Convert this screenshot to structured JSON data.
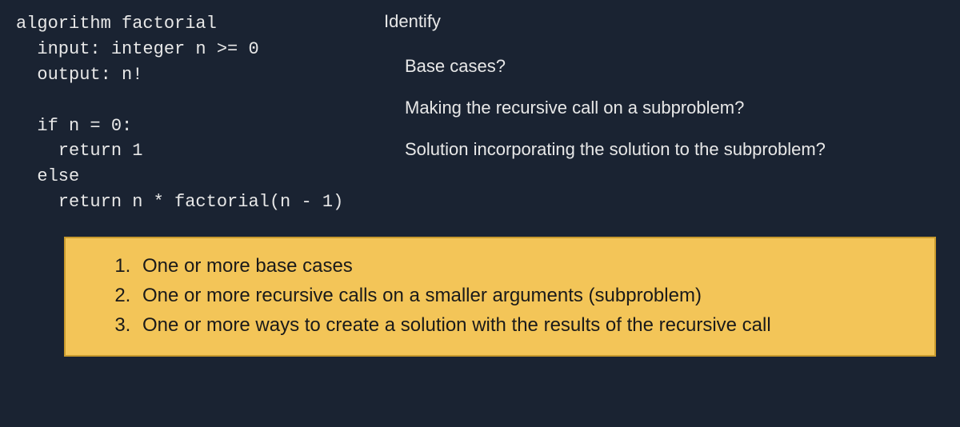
{
  "code": {
    "line1": "algorithm factorial",
    "line2": "  input: integer n >= 0",
    "line3": "  output: n!",
    "line4": "",
    "line5": "  if n = 0:",
    "line6": "    return 1",
    "line7": "  else",
    "line8": "    return n * factorial(n - 1)"
  },
  "right": {
    "title": "Identify",
    "q1": "Base cases?",
    "q2": "Making the recursive call on a subproblem?",
    "q3": "Solution incorporating the solution to the subproblem?"
  },
  "list": {
    "item1": "One or more base cases",
    "item2": "One or more recursive calls on a smaller arguments (subproblem)",
    "item3": "One or more ways to create a solution with the results of the recursive call"
  }
}
